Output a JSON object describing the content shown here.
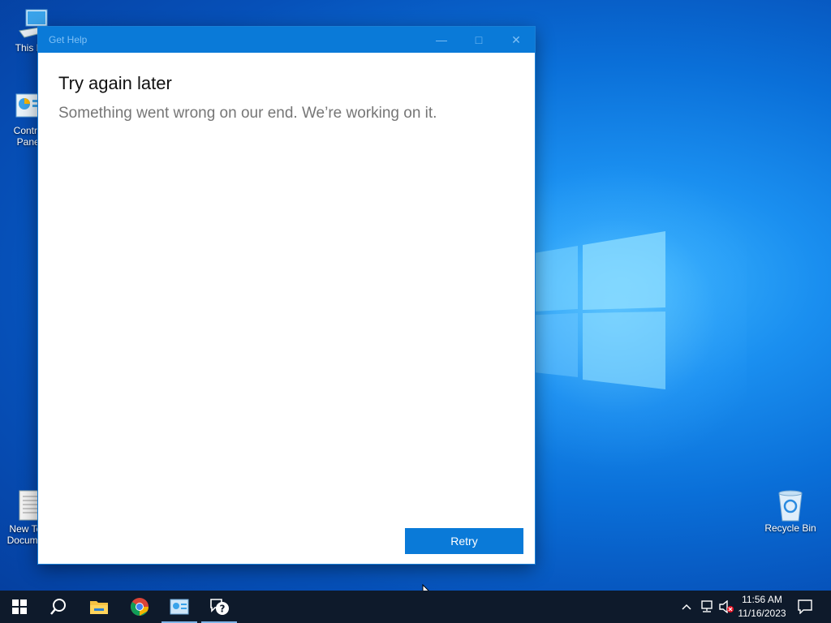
{
  "desktop": {
    "icons": [
      {
        "label": "This PC",
        "icon": "computer-icon"
      },
      {
        "label": "Control Panel",
        "icon": "control-panel-icon"
      },
      {
        "label": "New Text Document",
        "icon": "text-document-icon"
      },
      {
        "label": "Recycle Bin",
        "icon": "recycle-bin-icon"
      }
    ]
  },
  "window": {
    "title": "Get Help",
    "heading": "Try again later",
    "message": "Something went wrong on our end. We’re working on it.",
    "retry_label": "Retry"
  },
  "taskbar": {
    "apps": [
      "start-icon",
      "search-icon",
      "file-explorer-icon",
      "chrome-icon",
      "control-panel-icon",
      "get-help-icon"
    ],
    "clock": {
      "time": "11:56 AM",
      "date": "11/16/2023"
    }
  },
  "colors": {
    "accent": "#0a7ad8",
    "taskbar": "#0e1a2b"
  }
}
